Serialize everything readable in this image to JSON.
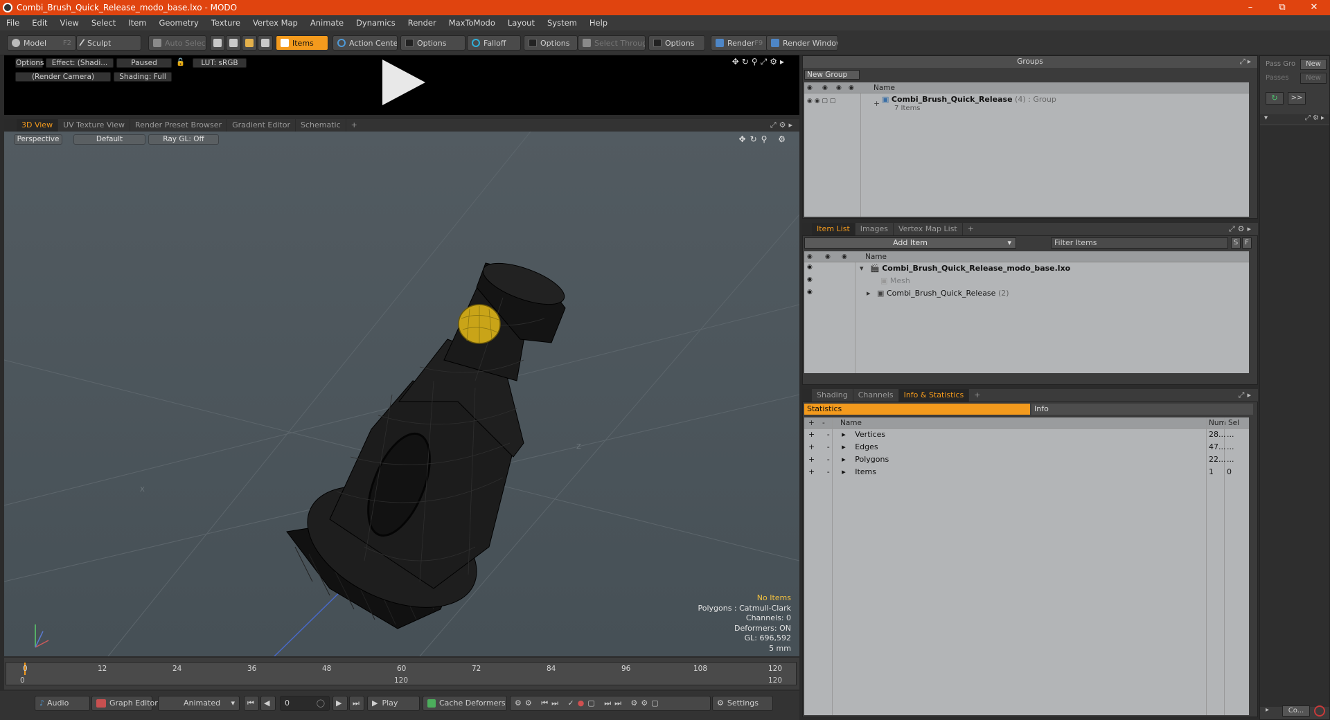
{
  "window": {
    "title": "Combi_Brush_Quick_Release_modo_base.lxo - MODO"
  },
  "menu": [
    "File",
    "Edit",
    "View",
    "Select",
    "Item",
    "Geometry",
    "Texture",
    "Vertex Map",
    "Animate",
    "Dynamics",
    "Render",
    "MaxToModo",
    "Layout",
    "System",
    "Help"
  ],
  "toolbar": {
    "model": "Model",
    "model_key": "F2",
    "sculpt": "Sculpt",
    "auto_select": "Auto Select",
    "items": "Items",
    "action_center": "Action Center",
    "options1": "Options",
    "falloff": "Falloff",
    "options2": "Options",
    "select_through": "Select Through",
    "options3": "Options",
    "render": "Render",
    "render_key": "F9",
    "render_window": "Render Window"
  },
  "preview": {
    "options": "Options",
    "effect": "Effect: (Shadi...",
    "paused": "Paused",
    "lut": "LUT: sRGB",
    "camera": "(Render Camera)",
    "shading": "Shading: Full"
  },
  "viewport_tabs": [
    "3D View",
    "UV Texture View",
    "Render Preset Browser",
    "Gradient Editor",
    "Schematic",
    "+"
  ],
  "viewport": {
    "perspective": "Perspective",
    "default": "Default",
    "raygl": "Ray GL: Off",
    "axis_label_x": "X",
    "axis_label_z": "Z",
    "stats": {
      "no_items": "No Items",
      "polygons": "Polygons : Catmull-Clark",
      "channels": "Channels: 0",
      "deformers": "Deformers: ON",
      "gl": "GL: 696,592",
      "scale": "5 mm"
    }
  },
  "timeline": {
    "ticks": [
      "0",
      "12",
      "24",
      "36",
      "48",
      "60",
      "72",
      "84",
      "96",
      "108",
      "120"
    ],
    "range_start": "0",
    "range_mid": "120",
    "range_end": "120"
  },
  "bottombar": {
    "audio": "Audio",
    "graph_editor": "Graph Editor",
    "animated": "Animated",
    "frame": "0",
    "play": "Play",
    "cache_deformers": "Cache Deformers",
    "settings": "Settings"
  },
  "groups": {
    "title": "Groups",
    "new_group": "New Group",
    "col_name": "Name",
    "item_name": "Combi_Brush_Quick_Release",
    "item_count": "(4)",
    "item_type": ": Group",
    "item_sub": "7 Items"
  },
  "itemlist": {
    "tabs": [
      "Item List",
      "Images",
      "Vertex Map List",
      "+"
    ],
    "add_item": "Add Item",
    "filter": "Filter Items",
    "s": "S",
    "f": "F",
    "col_name": "Name",
    "rows": [
      {
        "name": "Combi_Brush_Quick_Release_modo_base.lxo",
        "extra": ""
      },
      {
        "name": "Mesh",
        "extra": ""
      },
      {
        "name": "Combi_Brush_Quick_Release",
        "extra": "(2)"
      }
    ]
  },
  "info": {
    "tabs": [
      "Shading",
      "Channels",
      "Info & Statistics",
      "+"
    ],
    "statistics": "Statistics",
    "info": "Info",
    "col_name": "Name",
    "col_num": "Num",
    "col_sel": "Sel",
    "rows": [
      {
        "name": "Vertices",
        "num": "28...",
        "sel": "..."
      },
      {
        "name": "Edges",
        "num": "47...",
        "sel": "..."
      },
      {
        "name": "Polygons",
        "num": "22...",
        "sel": "..."
      },
      {
        "name": "Items",
        "num": "1",
        "sel": "0"
      }
    ]
  },
  "farright": {
    "pass_group": "Pass Gro",
    "passes": "Passes",
    "new1": "New",
    "new2": "New",
    "more": ">>",
    "co": "Co..."
  }
}
